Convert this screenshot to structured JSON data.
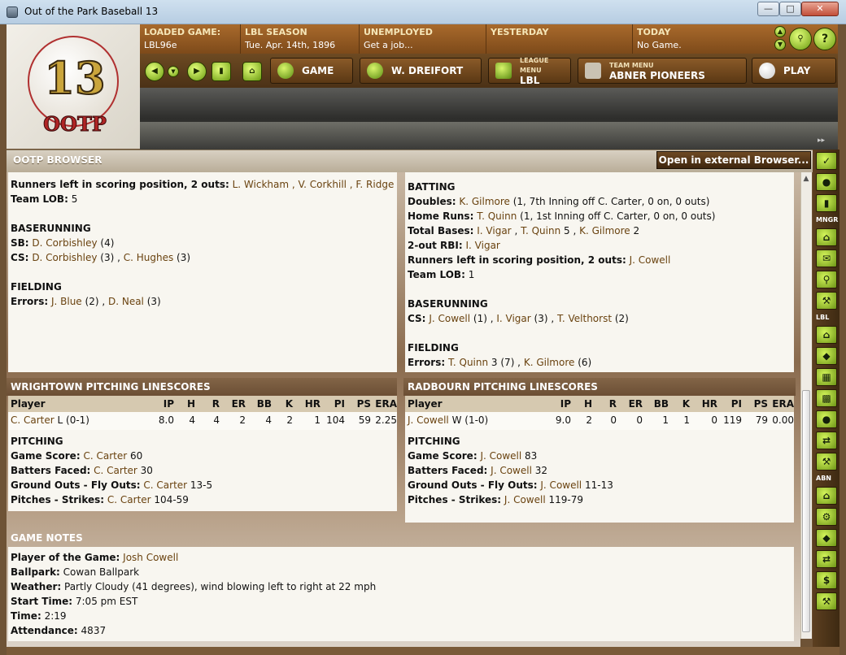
{
  "window": {
    "title": "Out of the Park Baseball 13"
  },
  "logo": {
    "number": "13",
    "text": "OOTP"
  },
  "status": [
    {
      "label": "LOADED GAME:",
      "value": "LBL96e"
    },
    {
      "label": "LBL SEASON",
      "value": "Tue. Apr. 14th, 1896"
    },
    {
      "label": "UNEMPLOYED",
      "value": "Get a job..."
    },
    {
      "label": "YESTERDAY",
      "value": ""
    },
    {
      "label": "TODAY",
      "value": "No Game."
    }
  ],
  "nav": {
    "game": "GAME",
    "manager": "W. DREIFORT",
    "league_small": "LEAGUE MENU",
    "league": "LBL",
    "team_small": "TEAM MENU",
    "team": "ABNER PIONEERS",
    "play": "PLAY"
  },
  "browser": {
    "title": "OOTP BROWSER",
    "external_button": "Open in external Browser..."
  },
  "left_top": {
    "lines": [
      {
        "label": "Runners left in scoring position, 2 outs:",
        "players": "L. Wickham , V. Corkhill , F. Ridge",
        "rest": ""
      },
      {
        "label": "Team LOB:",
        "players": "",
        "rest": " 5"
      }
    ],
    "baserunning_title": "BASERUNNING",
    "sb": {
      "label": "SB:",
      "players": "D. Corbishley",
      "rest": " (4)"
    },
    "cs": {
      "label": "CS:",
      "players": "D. Corbishley",
      "rest": " (3) , ",
      "players2": "C. Hughes",
      "rest2": " (3)"
    },
    "fielding_title": "FIELDING",
    "errors": {
      "label": "Errors:",
      "players": "J. Blue",
      "rest": " (2) , ",
      "players2": "D. Neal",
      "rest2": " (3)"
    }
  },
  "right_top": {
    "batting_title": "BATTING",
    "doubles": {
      "label": "Doubles:",
      "players": "K. Gilmore",
      "rest": " (1, 7th Inning off C. Carter, 0 on, 0 outs)"
    },
    "homeruns": {
      "label": "Home Runs:",
      "players": "T. Quinn",
      "rest": " (1, 1st Inning off C. Carter, 0 on, 0 outs)"
    },
    "totalbases": {
      "label": "Total Bases:",
      "players": "I. Vigar",
      "rest": " , ",
      "players2": "T. Quinn",
      "rest2": " 5 , ",
      "players3": "K. Gilmore",
      "rest3": " 2"
    },
    "rbi": {
      "label": "2-out RBI:",
      "players": "I. Vigar"
    },
    "risp": {
      "label": "Runners left in scoring position, 2 outs:",
      "players": "J. Cowell"
    },
    "lob": {
      "label": "Team LOB:",
      "rest": " 1"
    },
    "baserunning_title": "BASERUNNING",
    "cs": {
      "label": "CS:",
      "players": "J. Cowell",
      "rest": " (1) , ",
      "players2": "I. Vigar",
      "rest2": " (3) , ",
      "players3": "T. Velthorst",
      "rest3": " (2)"
    },
    "fielding_title": "FIELDING",
    "errors": {
      "label": "Errors:",
      "players": "T. Quinn",
      "rest": " 3 (7) , ",
      "players2": "K. Gilmore",
      "rest2": " (6)"
    }
  },
  "pitching_columns": [
    "Player",
    "IP",
    "H",
    "R",
    "ER",
    "BB",
    "K",
    "HR",
    "PI",
    "PS",
    "ERA"
  ],
  "wrightown": {
    "title": "WRIGHTOWN PITCHING LINESCORES",
    "row": {
      "player": "C. Carter",
      "decision": " L (0-1)",
      "ip": "8.0",
      "h": "4",
      "r": "4",
      "er": "2",
      "bb": "4",
      "k": "2",
      "hr": "1",
      "pi": "104",
      "ps": "59",
      "era": "2.25"
    },
    "pitching_title": "PITCHING",
    "game_score": {
      "label": "Game Score:",
      "player": "C. Carter",
      "value": " 60"
    },
    "batters_faced": {
      "label": "Batters Faced:",
      "player": "C. Carter",
      "value": " 30"
    },
    "go_fo": {
      "label": "Ground Outs - Fly Outs:",
      "player": "C. Carter",
      "value": " 13-5"
    },
    "pitches": {
      "label": "Pitches - Strikes:",
      "player": "C. Carter",
      "value": " 104-59"
    }
  },
  "radbourn": {
    "title": "RADBOURN PITCHING LINESCORES",
    "row": {
      "player": "J. Cowell",
      "decision": " W (1-0)",
      "ip": "9.0",
      "h": "2",
      "r": "0",
      "er": "0",
      "bb": "1",
      "k": "1",
      "hr": "0",
      "pi": "119",
      "ps": "79",
      "era": "0.00"
    },
    "pitching_title": "PITCHING",
    "game_score": {
      "label": "Game Score:",
      "player": "J. Cowell",
      "value": " 83"
    },
    "batters_faced": {
      "label": "Batters Faced:",
      "player": "J. Cowell",
      "value": " 32"
    },
    "go_fo": {
      "label": "Ground Outs - Fly Outs:",
      "player": "J. Cowell",
      "value": " 11-13"
    },
    "pitches": {
      "label": "Pitches - Strikes:",
      "player": "J. Cowell",
      "value": " 119-79"
    }
  },
  "notes": {
    "title": "GAME NOTES",
    "potg": {
      "label": "Player of the Game:",
      "value": "Josh Cowell"
    },
    "ballpark": {
      "label": "Ballpark:",
      "value": "  Cowan Ballpark"
    },
    "weather": {
      "label": "Weather:",
      "value": "  Partly Cloudy (41 degrees), wind blowing left to right at 22 mph"
    },
    "start": {
      "label": "Start Time:",
      "value": "  7:05 pm EST"
    },
    "time": {
      "label": "Time:",
      "value": "  2:19"
    },
    "attendance": {
      "label": "Attendance:",
      "value": "  4837"
    }
  },
  "sidebar": {
    "mngr": "MNGR",
    "lbl": "LBL",
    "abn": "ABN"
  }
}
